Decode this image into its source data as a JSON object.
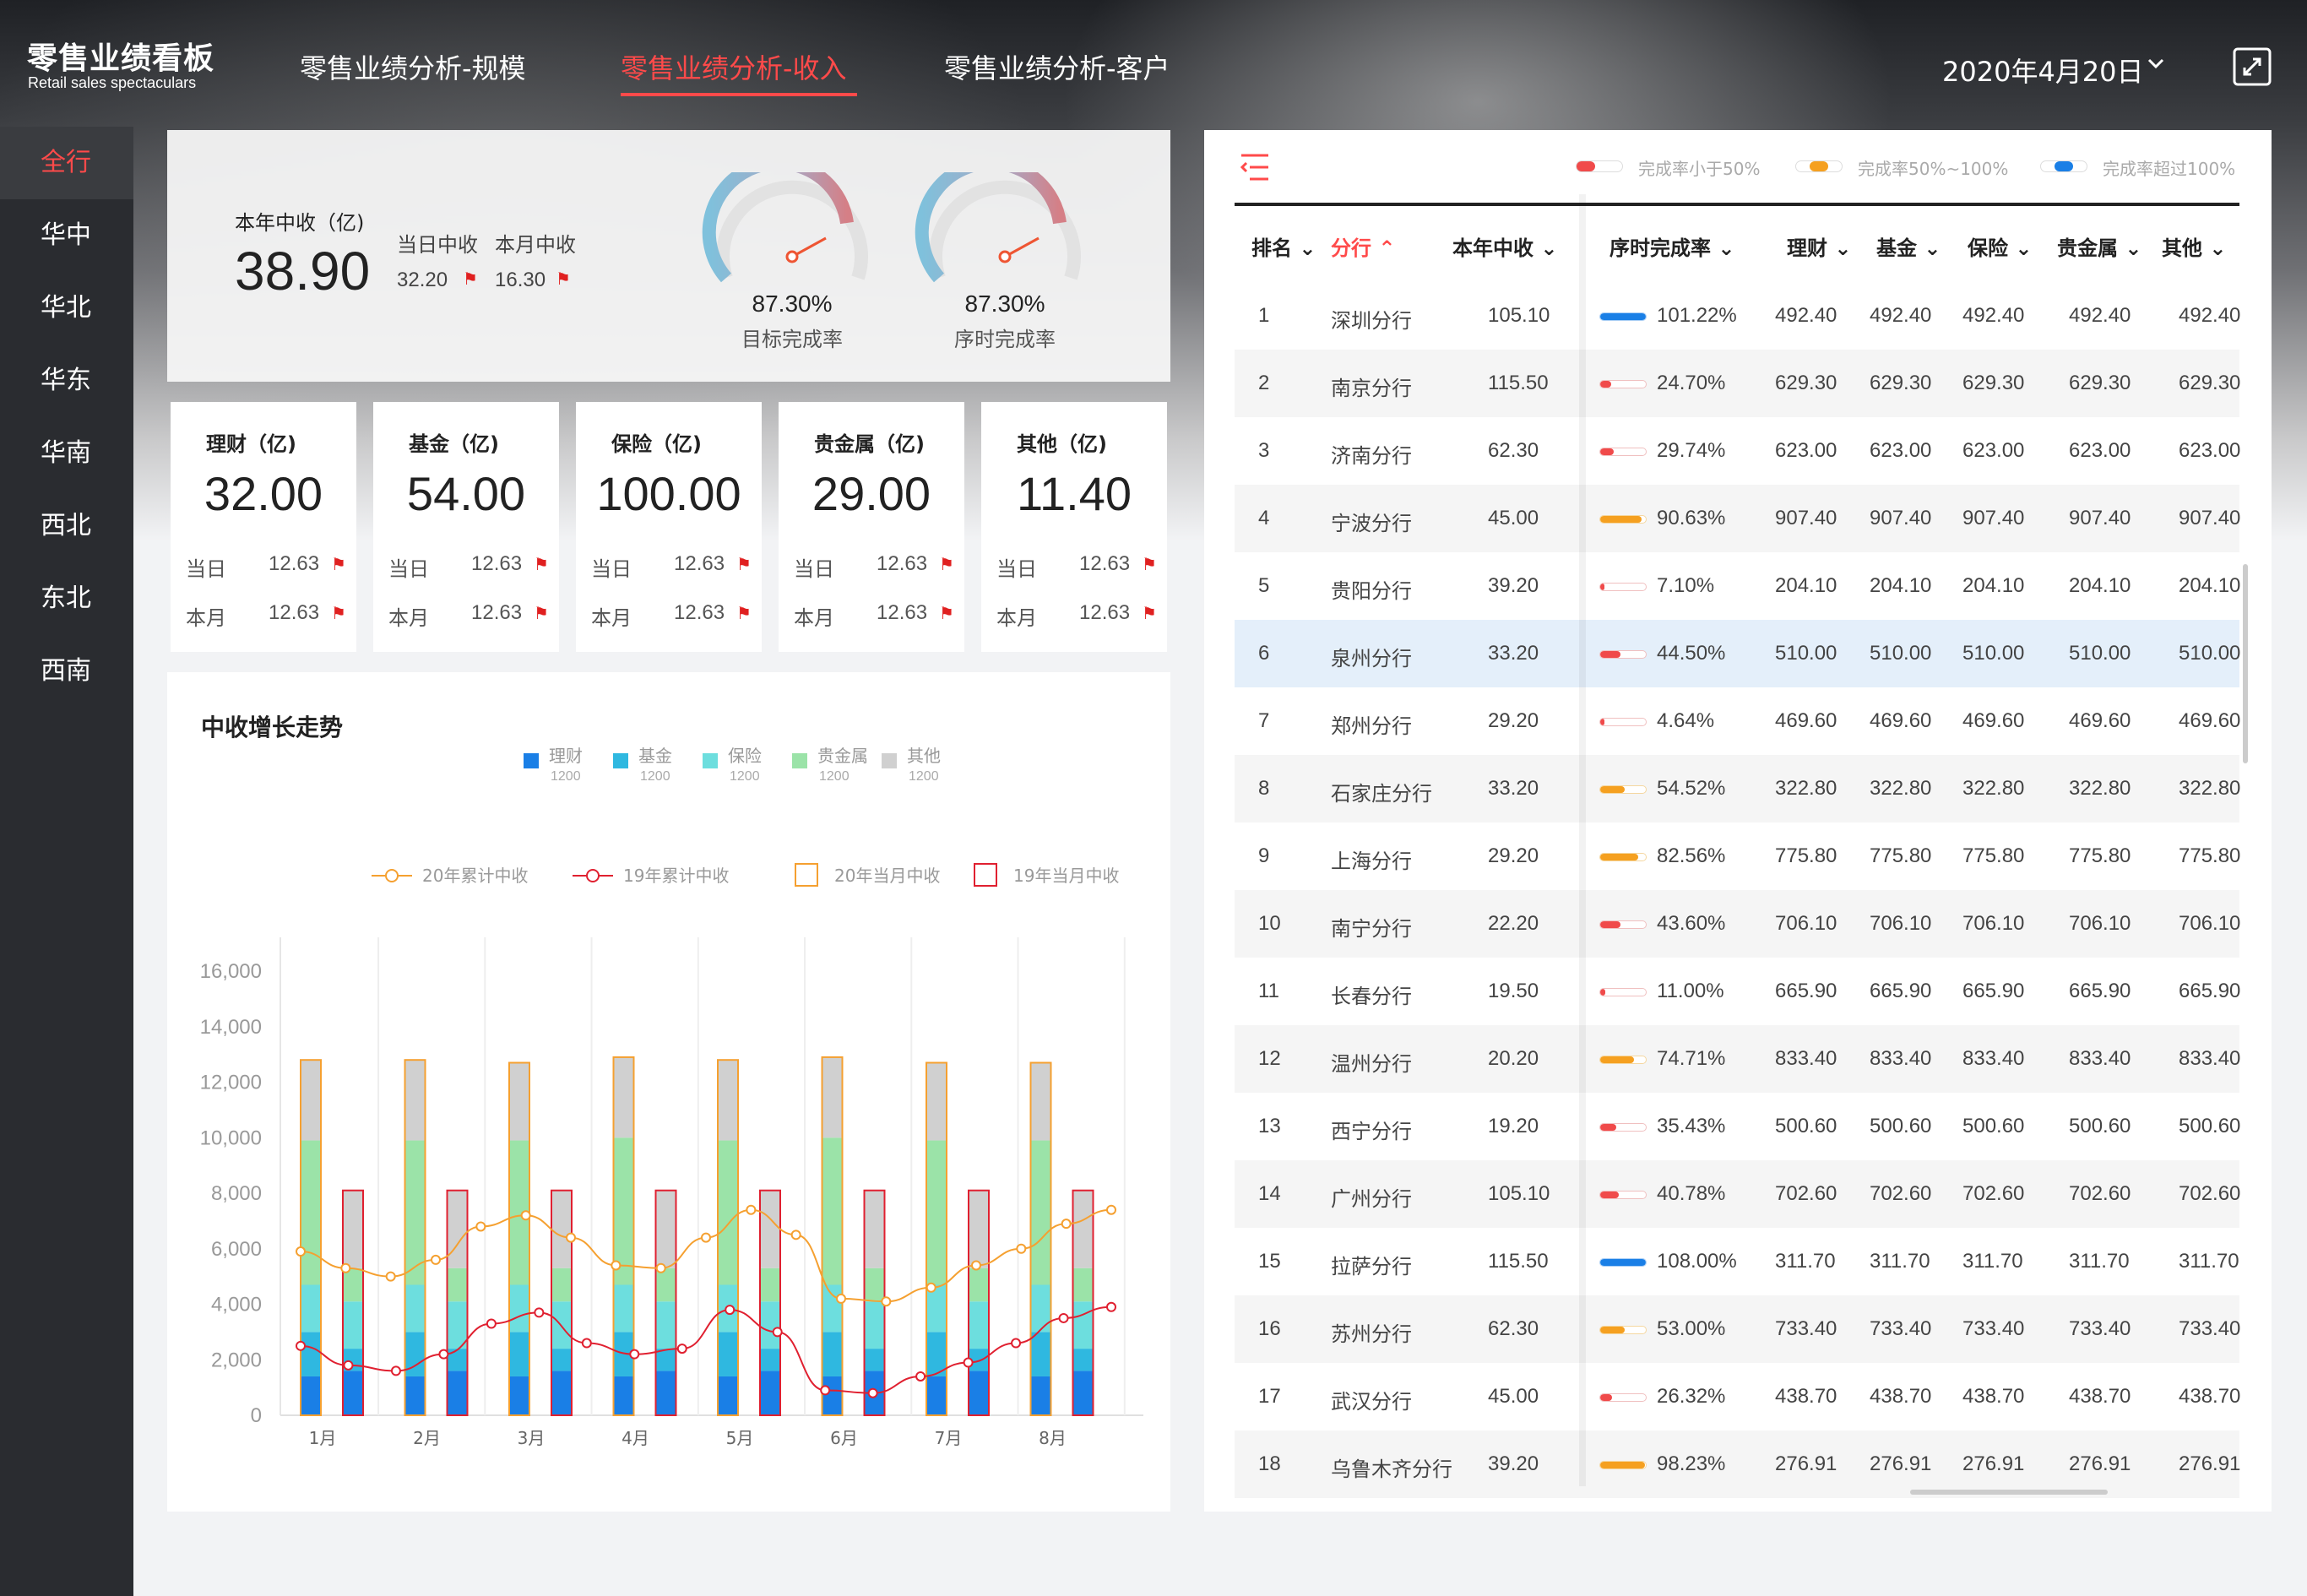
{
  "app": {
    "title": "零售业绩看板",
    "subtitle": "Retail sales spectaculars"
  },
  "nav": {
    "tabs": [
      {
        "label": "零售业绩分析-规模",
        "active": false
      },
      {
        "label": "零售业绩分析-收入",
        "active": true
      },
      {
        "label": "零售业绩分析-客户",
        "active": false
      }
    ],
    "date": "2020年4月20日"
  },
  "sidebar": {
    "items": [
      "全行",
      "华中",
      "华北",
      "华东",
      "华南",
      "西北",
      "东北",
      "西南"
    ],
    "active_index": 0
  },
  "summary": {
    "year_label": "本年中收（亿)",
    "year_value": "38.90",
    "day_label": "当日中收",
    "day_value": "32.20",
    "month_label": "本月中收",
    "month_value": "16.30",
    "gauges": [
      {
        "value": "87.30%",
        "label": "目标完成率",
        "fraction": 0.873
      },
      {
        "value": "87.30%",
        "label": "序时完成率",
        "fraction": 0.873
      }
    ]
  },
  "categories": [
    {
      "title": "理财（亿)",
      "value": "32.00",
      "day_label": "当日",
      "day_value": "12.63",
      "month_label": "本月",
      "month_value": "12.63"
    },
    {
      "title": "基金（亿)",
      "value": "54.00",
      "day_label": "当日",
      "day_value": "12.63",
      "month_label": "本月",
      "month_value": "12.63"
    },
    {
      "title": "保险（亿)",
      "value": "100.00",
      "day_label": "当日",
      "day_value": "12.63",
      "month_label": "本月",
      "month_value": "12.63"
    },
    {
      "title": "贵金属（亿)",
      "value": "29.00",
      "day_label": "当日",
      "day_value": "12.63",
      "month_label": "本月",
      "month_value": "12.63"
    },
    {
      "title": "其他（亿)",
      "value": "11.40",
      "day_label": "当日",
      "day_value": "12.63",
      "month_label": "本月",
      "month_value": "12.63"
    }
  ],
  "chart_title": "中收增长走势",
  "chart_data": {
    "type": "bar",
    "categories": [
      "1月",
      "2月",
      "3月",
      "4月",
      "5月",
      "6月",
      "7月",
      "8月"
    ],
    "ylim": [
      0,
      16000
    ],
    "yticks": [
      "0",
      "2,000",
      "4,000",
      "6,000",
      "8,000",
      "10,000",
      "12,000",
      "14,000",
      "16,000"
    ],
    "stack_legend": [
      {
        "name": "理财",
        "value": "1200",
        "color": "#1a7fe6"
      },
      {
        "name": "基金",
        "value": "1200",
        "color": "#2fb8e0"
      },
      {
        "name": "保险",
        "value": "1200",
        "color": "#6ddede"
      },
      {
        "name": "贵金属",
        "value": "1200",
        "color": "#9be3a8"
      },
      {
        "name": "其他",
        "value": "1200",
        "color": "#d0d0d0"
      }
    ],
    "line_legend": [
      {
        "name": "20年累计中收",
        "color": "#f5a030",
        "kind": "line"
      },
      {
        "name": "19年累计中收",
        "color": "#e02030",
        "kind": "line"
      },
      {
        "name": "20年当月中收",
        "color": "#f5a030",
        "kind": "box"
      },
      {
        "name": "19年当月中收",
        "color": "#e02030",
        "kind": "box"
      }
    ],
    "bars_2020": [
      [
        1400,
        1600,
        1700,
        5200,
        2900
      ],
      [
        1400,
        1600,
        1700,
        5200,
        2900
      ],
      [
        1400,
        1600,
        1700,
        5200,
        2800
      ],
      [
        1400,
        1600,
        1700,
        5300,
        2900
      ],
      [
        1400,
        1600,
        1700,
        5200,
        2900
      ],
      [
        1400,
        1600,
        1700,
        5300,
        2900
      ],
      [
        1400,
        1600,
        1700,
        5200,
        2800
      ],
      [
        1400,
        1600,
        1700,
        5200,
        2800
      ]
    ],
    "bars_2019": [
      [
        1600,
        800,
        1700,
        1200,
        2800
      ],
      [
        1600,
        800,
        1700,
        1200,
        2800
      ],
      [
        1600,
        800,
        1700,
        1200,
        2800
      ],
      [
        1600,
        800,
        1700,
        1200,
        2800
      ],
      [
        1600,
        800,
        1700,
        1200,
        2800
      ],
      [
        1600,
        800,
        1700,
        1200,
        2800
      ],
      [
        1600,
        800,
        1700,
        1200,
        2800
      ],
      [
        1600,
        800,
        1700,
        1200,
        2800
      ]
    ],
    "line_2020": [
      5900,
      5300,
      5000,
      5600,
      6800,
      7200,
      6400,
      5400,
      5300,
      6400,
      7400,
      6500,
      4200,
      4100,
      4600,
      5400,
      6000,
      6900,
      7400
    ],
    "line_2019": [
      2500,
      1800,
      1600,
      2200,
      3300,
      3700,
      2600,
      2200,
      2400,
      3800,
      3000,
      900,
      800,
      1400,
      1900,
      2600,
      3500,
      3900
    ]
  },
  "table": {
    "legend": [
      {
        "label": "完成率小于50%",
        "color": "#f04a4a"
      },
      {
        "label": "完成率50%~100%",
        "color": "#f5a020"
      },
      {
        "label": "完成率超过100%",
        "color": "#1a7fe6"
      }
    ],
    "headers": [
      "排名",
      "分行",
      "本年中收",
      "序时完成率",
      "理财",
      "基金",
      "保险",
      "贵金属",
      "其他"
    ],
    "rows": [
      [
        "1",
        "深圳分行",
        "105.10",
        "101.22%",
        "492.40",
        "492.40",
        "492.40",
        "492.40",
        "492.40"
      ],
      [
        "2",
        "南京分行",
        "115.50",
        "24.70%",
        "629.30",
        "629.30",
        "629.30",
        "629.30",
        "629.30"
      ],
      [
        "3",
        "济南分行",
        "62.30",
        "29.74%",
        "623.00",
        "623.00",
        "623.00",
        "623.00",
        "623.00"
      ],
      [
        "4",
        "宁波分行",
        "45.00",
        "90.63%",
        "907.40",
        "907.40",
        "907.40",
        "907.40",
        "907.40"
      ],
      [
        "5",
        "贵阳分行",
        "39.20",
        "7.10%",
        "204.10",
        "204.10",
        "204.10",
        "204.10",
        "204.10"
      ],
      [
        "6",
        "泉州分行",
        "33.20",
        "44.50%",
        "510.00",
        "510.00",
        "510.00",
        "510.00",
        "510.00"
      ],
      [
        "7",
        "郑州分行",
        "29.20",
        "4.64%",
        "469.60",
        "469.60",
        "469.60",
        "469.60",
        "469.60"
      ],
      [
        "8",
        "石家庄分行",
        "33.20",
        "54.52%",
        "322.80",
        "322.80",
        "322.80",
        "322.80",
        "322.80"
      ],
      [
        "9",
        "上海分行",
        "29.20",
        "82.56%",
        "775.80",
        "775.80",
        "775.80",
        "775.80",
        "775.80"
      ],
      [
        "10",
        "南宁分行",
        "22.20",
        "43.60%",
        "706.10",
        "706.10",
        "706.10",
        "706.10",
        "706.10"
      ],
      [
        "11",
        "长春分行",
        "19.50",
        "11.00%",
        "665.90",
        "665.90",
        "665.90",
        "665.90",
        "665.90"
      ],
      [
        "12",
        "温州分行",
        "20.20",
        "74.71%",
        "833.40",
        "833.40",
        "833.40",
        "833.40",
        "833.40"
      ],
      [
        "13",
        "西宁分行",
        "19.20",
        "35.43%",
        "500.60",
        "500.60",
        "500.60",
        "500.60",
        "500.60"
      ],
      [
        "14",
        "广州分行",
        "105.10",
        "40.78%",
        "702.60",
        "702.60",
        "702.60",
        "702.60",
        "702.60"
      ],
      [
        "15",
        "拉萨分行",
        "115.50",
        "108.00%",
        "311.70",
        "311.70",
        "311.70",
        "311.70",
        "311.70"
      ],
      [
        "16",
        "苏州分行",
        "62.30",
        "53.00%",
        "733.40",
        "733.40",
        "733.40",
        "733.40",
        "733.40"
      ],
      [
        "17",
        "武汉分行",
        "45.00",
        "26.32%",
        "438.70",
        "438.70",
        "438.70",
        "438.70",
        "438.70"
      ],
      [
        "18",
        "乌鲁木齐分行",
        "39.20",
        "98.23%",
        "276.91",
        "276.91",
        "276.91",
        "276.91",
        "276.91"
      ]
    ],
    "highlight_row": 5
  }
}
